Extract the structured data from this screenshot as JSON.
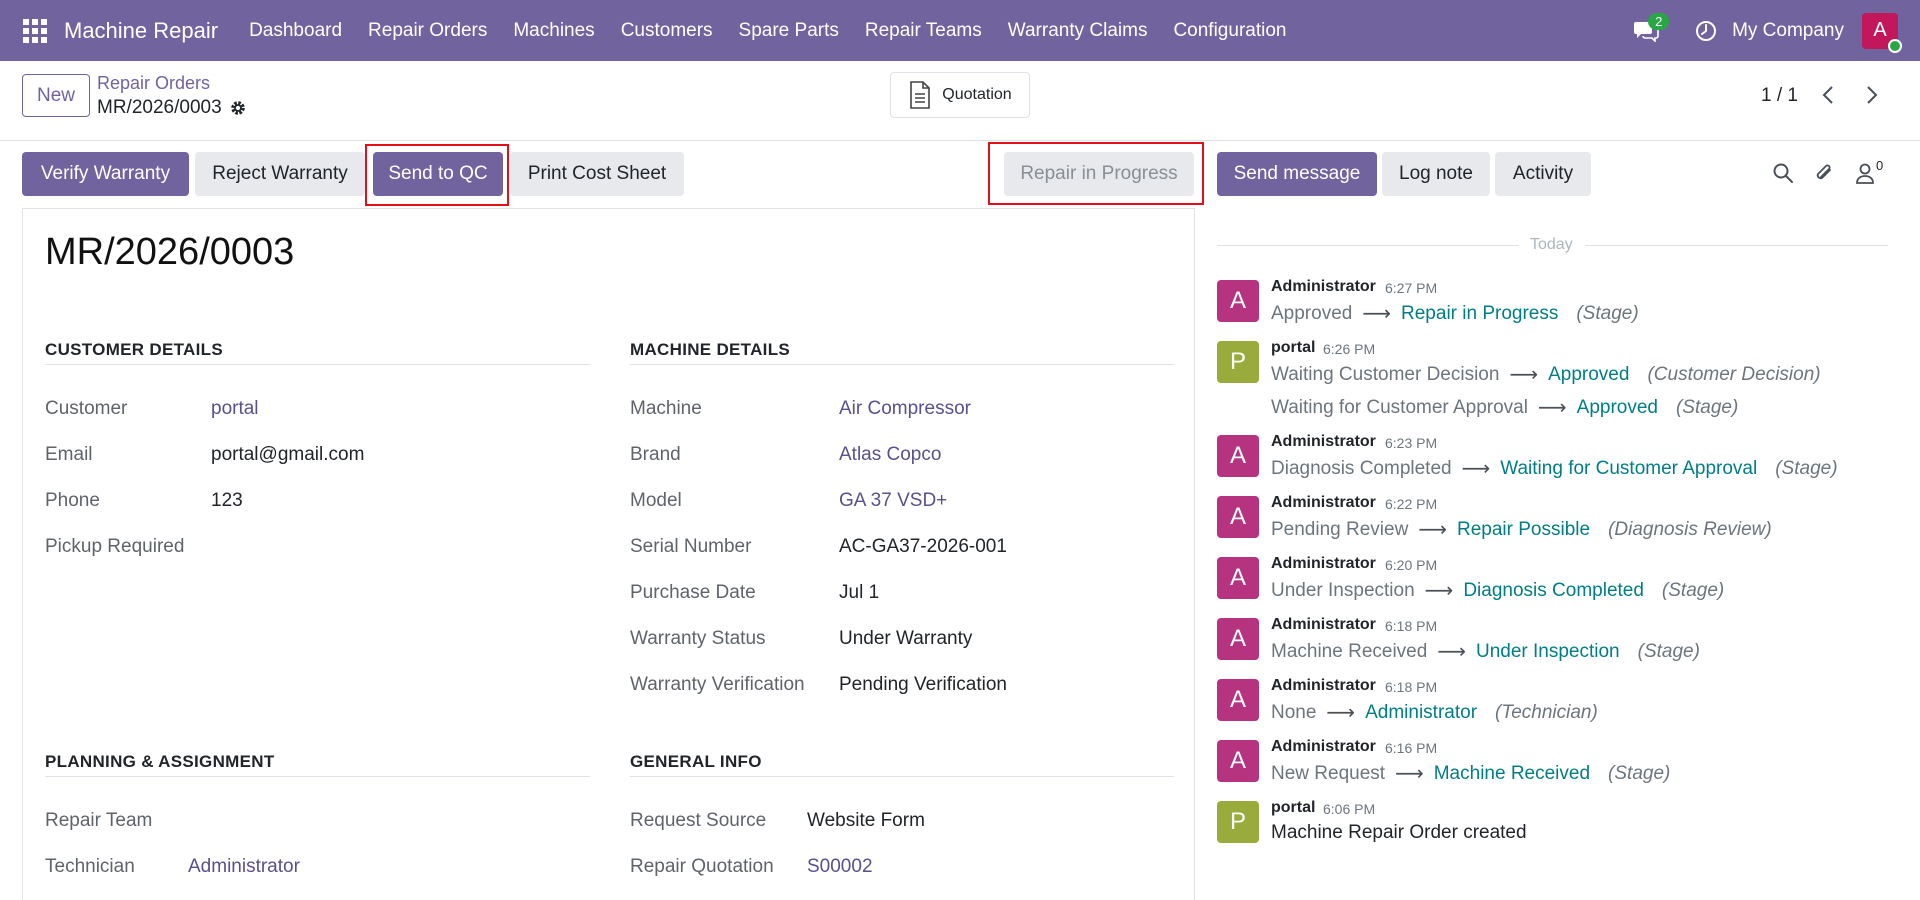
{
  "navbar": {
    "app_name": "Machine Repair",
    "menu": [
      "Dashboard",
      "Repair Orders",
      "Machines",
      "Customers",
      "Spare Parts",
      "Repair Teams",
      "Warranty Claims",
      "Configuration"
    ],
    "chat_count": "2",
    "company": "My Company",
    "user_initial": "A",
    "colors": {
      "bar": "#71639e",
      "avatar": "#c2185b",
      "badge": "#28a745"
    }
  },
  "control": {
    "new_label": "New",
    "breadcrumb": "Repair Orders",
    "record": "MR/2026/0003",
    "quotation_label": "Quotation",
    "pager": "1 / 1"
  },
  "actions": {
    "verify_warranty": "Verify Warranty",
    "reject_warranty": "Reject Warranty",
    "send_to_qc": "Send to QC",
    "print_cost_sheet": "Print Cost Sheet",
    "stage": "Repair in Progress"
  },
  "form": {
    "title": "MR/2026/0003",
    "customer_details": {
      "heading": "CUSTOMER DETAILS",
      "customer_label": "Customer",
      "customer": "portal",
      "email_label": "Email",
      "email": "portal@gmail.com",
      "phone_label": "Phone",
      "phone": "123",
      "pickup_label": "Pickup Required"
    },
    "machine_details": {
      "heading": "MACHINE DETAILS",
      "machine_label": "Machine",
      "machine": "Air Compressor",
      "brand_label": "Brand",
      "brand": "Atlas Copco",
      "model_label": "Model",
      "model": "GA 37 VSD+",
      "serial_label": "Serial Number",
      "serial": "AC-GA37-2026-001",
      "purchase_label": "Purchase Date",
      "purchase": "Jul 1",
      "warranty_status_label": "Warranty Status",
      "warranty_status": "Under Warranty",
      "warranty_verif_label": "Warranty Verification",
      "warranty_verif": "Pending Verification"
    },
    "planning": {
      "heading": "PLANNING & ASSIGNMENT",
      "team_label": "Repair Team",
      "tech_label": "Technician",
      "tech": "Administrator"
    },
    "general": {
      "heading": "GENERAL INFO",
      "source_label": "Request Source",
      "source": "Website Form",
      "quotation_label": "Repair Quotation",
      "quotation": "S00002"
    }
  },
  "chatter": {
    "send_message": "Send message",
    "log_note": "Log note",
    "activity": "Activity",
    "follower_count": "0",
    "today": "Today",
    "messages": [
      {
        "initial": "A",
        "author": "Administrator",
        "time": "6:27 PM",
        "changes": [
          {
            "old": "Approved",
            "new": "Repair in Progress",
            "field": "(Stage)"
          }
        ]
      },
      {
        "initial": "P",
        "author": "portal",
        "time": "6:26 PM",
        "changes": [
          {
            "old": "Waiting Customer Decision",
            "new": "Approved",
            "field": "(Customer Decision)"
          },
          {
            "old": "Waiting for Customer Approval",
            "new": "Approved",
            "field": "(Stage)"
          }
        ]
      },
      {
        "initial": "A",
        "author": "Administrator",
        "time": "6:23 PM",
        "changes": [
          {
            "old": "Diagnosis Completed",
            "new": "Waiting for Customer Approval",
            "field": "(Stage)"
          }
        ]
      },
      {
        "initial": "A",
        "author": "Administrator",
        "time": "6:22 PM",
        "changes": [
          {
            "old": "Pending Review",
            "new": "Repair Possible",
            "field": "(Diagnosis Review)"
          }
        ]
      },
      {
        "initial": "A",
        "author": "Administrator",
        "time": "6:20 PM",
        "changes": [
          {
            "old": "Under Inspection",
            "new": "Diagnosis Completed",
            "field": "(Stage)"
          }
        ]
      },
      {
        "initial": "A",
        "author": "Administrator",
        "time": "6:18 PM",
        "changes": [
          {
            "old": "Machine Received",
            "new": "Under Inspection",
            "field": "(Stage)"
          }
        ]
      },
      {
        "initial": "A",
        "author": "Administrator",
        "time": "6:18 PM",
        "changes": [
          {
            "old": "None",
            "new": "Administrator",
            "field": "(Technician)"
          }
        ]
      },
      {
        "initial": "A",
        "author": "Administrator",
        "time": "6:16 PM",
        "changes": [
          {
            "old": "New Request",
            "new": "Machine Received",
            "field": "(Stage)"
          }
        ]
      },
      {
        "initial": "P",
        "author": "portal",
        "time": "6:06 PM",
        "body": "Machine Repair Order created"
      }
    ],
    "arrow": "⟶",
    "colors": {
      "admin_avatar": "#b5337f",
      "portal_avatar": "#98ab3b"
    }
  }
}
